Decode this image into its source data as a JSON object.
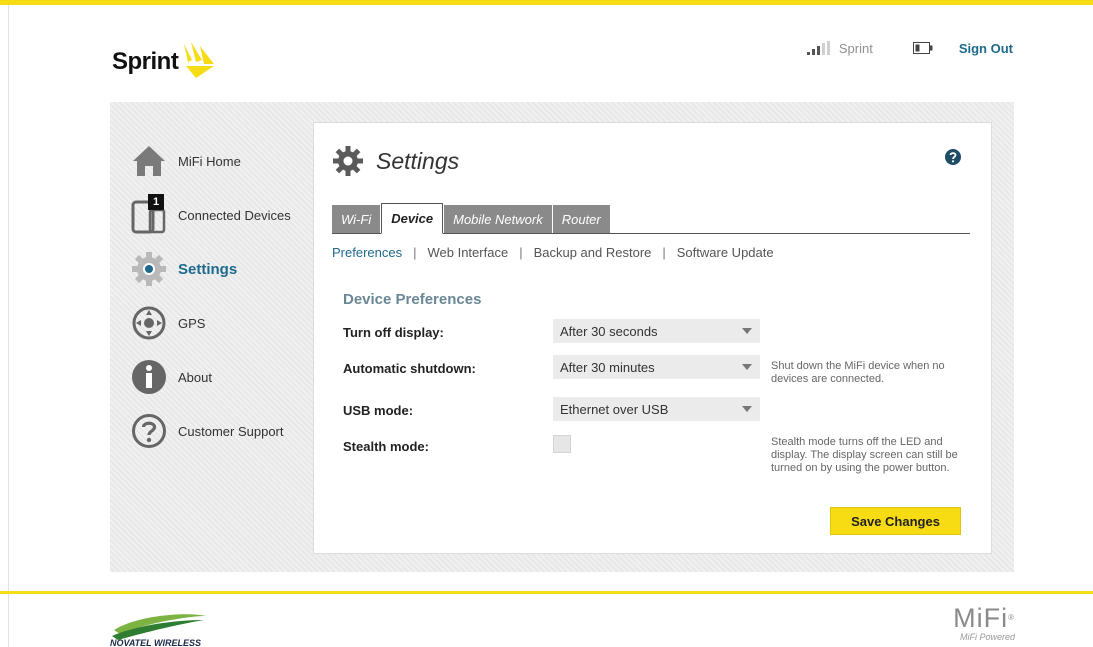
{
  "brand": {
    "logo_text": "Sprint",
    "accent_color": "#f6dc14",
    "link_color": "#1e6a8c"
  },
  "status": {
    "signal_icon": "signal-bars-icon",
    "carrier": "Sprint",
    "battery_icon": "battery-icon",
    "sign_out": "Sign Out"
  },
  "sidebar": {
    "items": [
      {
        "label": "MiFi Home",
        "icon": "home-icon",
        "badge": ""
      },
      {
        "label": "Connected Devices",
        "icon": "devices-icon",
        "badge": "1"
      },
      {
        "label": "Settings",
        "icon": "gear-icon",
        "badge": "",
        "active": true
      },
      {
        "label": "GPS",
        "icon": "gps-icon",
        "badge": ""
      },
      {
        "label": "About",
        "icon": "info-icon",
        "badge": ""
      },
      {
        "label": "Customer Support",
        "icon": "question-icon",
        "badge": ""
      }
    ]
  },
  "page": {
    "title": "Settings",
    "help_icon": "help-icon"
  },
  "tabs": [
    {
      "label": "Wi-Fi",
      "active": false
    },
    {
      "label": "Device",
      "active": true
    },
    {
      "label": "Mobile Network",
      "active": false
    },
    {
      "label": "Router",
      "active": false
    }
  ],
  "subnav": [
    {
      "label": "Preferences",
      "active": true
    },
    {
      "label": "Web Interface",
      "active": false
    },
    {
      "label": "Backup and Restore",
      "active": false
    },
    {
      "label": "Software Update",
      "active": false
    }
  ],
  "form": {
    "section_title": "Device Preferences",
    "turn_off_display": {
      "label": "Turn off display:",
      "value": "After 30 seconds"
    },
    "automatic_shutdown": {
      "label": "Automatic shutdown:",
      "value": "After 30 minutes",
      "help_line1": "Shut down the MiFi device when no",
      "help_line2": "devices are connected."
    },
    "usb_mode": {
      "label": "USB mode:",
      "value": "Ethernet over USB"
    },
    "stealth_mode": {
      "label": "Stealth mode:",
      "checked": false,
      "help_line1": "Stealth mode turns off the LED and",
      "help_line2": "display. The display screen can still be",
      "help_line3": "turned on by using the power button."
    },
    "save_label": "Save Changes"
  },
  "footer": {
    "left_logo_text": "NOVATEL WIRELESS",
    "right_logo_text": "MiFi",
    "right_logo_sub": "MiFi Powered"
  }
}
